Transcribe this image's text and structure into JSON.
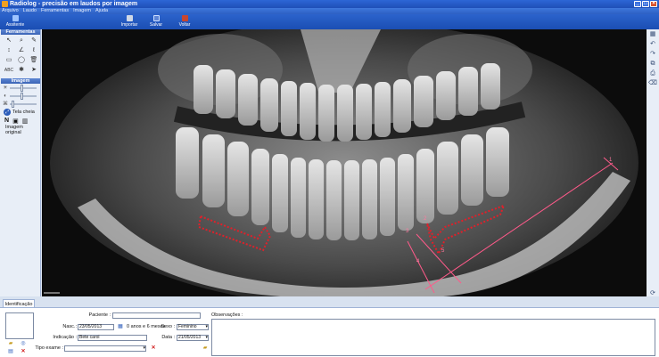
{
  "window": {
    "title": "Radiolog - precisão em laudos por imagem"
  },
  "menu": [
    "Arquivo",
    "Laudo",
    "Ferramentas",
    "Imagem",
    "Ajuda"
  ],
  "toolbar": {
    "assistant": "Assitente",
    "capture": "Importar",
    "save": "Salvar",
    "exit": "Voltar"
  },
  "left_panel": {
    "tools_header": "Ferramentas",
    "image_header": "Imagem",
    "fullscreen": "Tela cheia",
    "original": "Imagem original",
    "n_label": "N"
  },
  "viewer": {
    "measure_labels": [
      "1",
      "2",
      "3",
      "4",
      "5"
    ]
  },
  "bottom": {
    "tab": "Identificação",
    "patient_label": "Paciente :",
    "patient_value": "",
    "birth_label": "Nasc.:",
    "birth_value": "23/05/2013",
    "age_text": "0 anos e 6 meses",
    "sex_label": "Sexo :",
    "sex_value": "Feminino",
    "indication_label": "Indicação :",
    "indication_value": "Bete carol",
    "date_label": "Data :",
    "date_value": "21/05/2013",
    "exam_label": "Tipo exame :",
    "exam_value": "",
    "observations_label": "Observações :"
  }
}
